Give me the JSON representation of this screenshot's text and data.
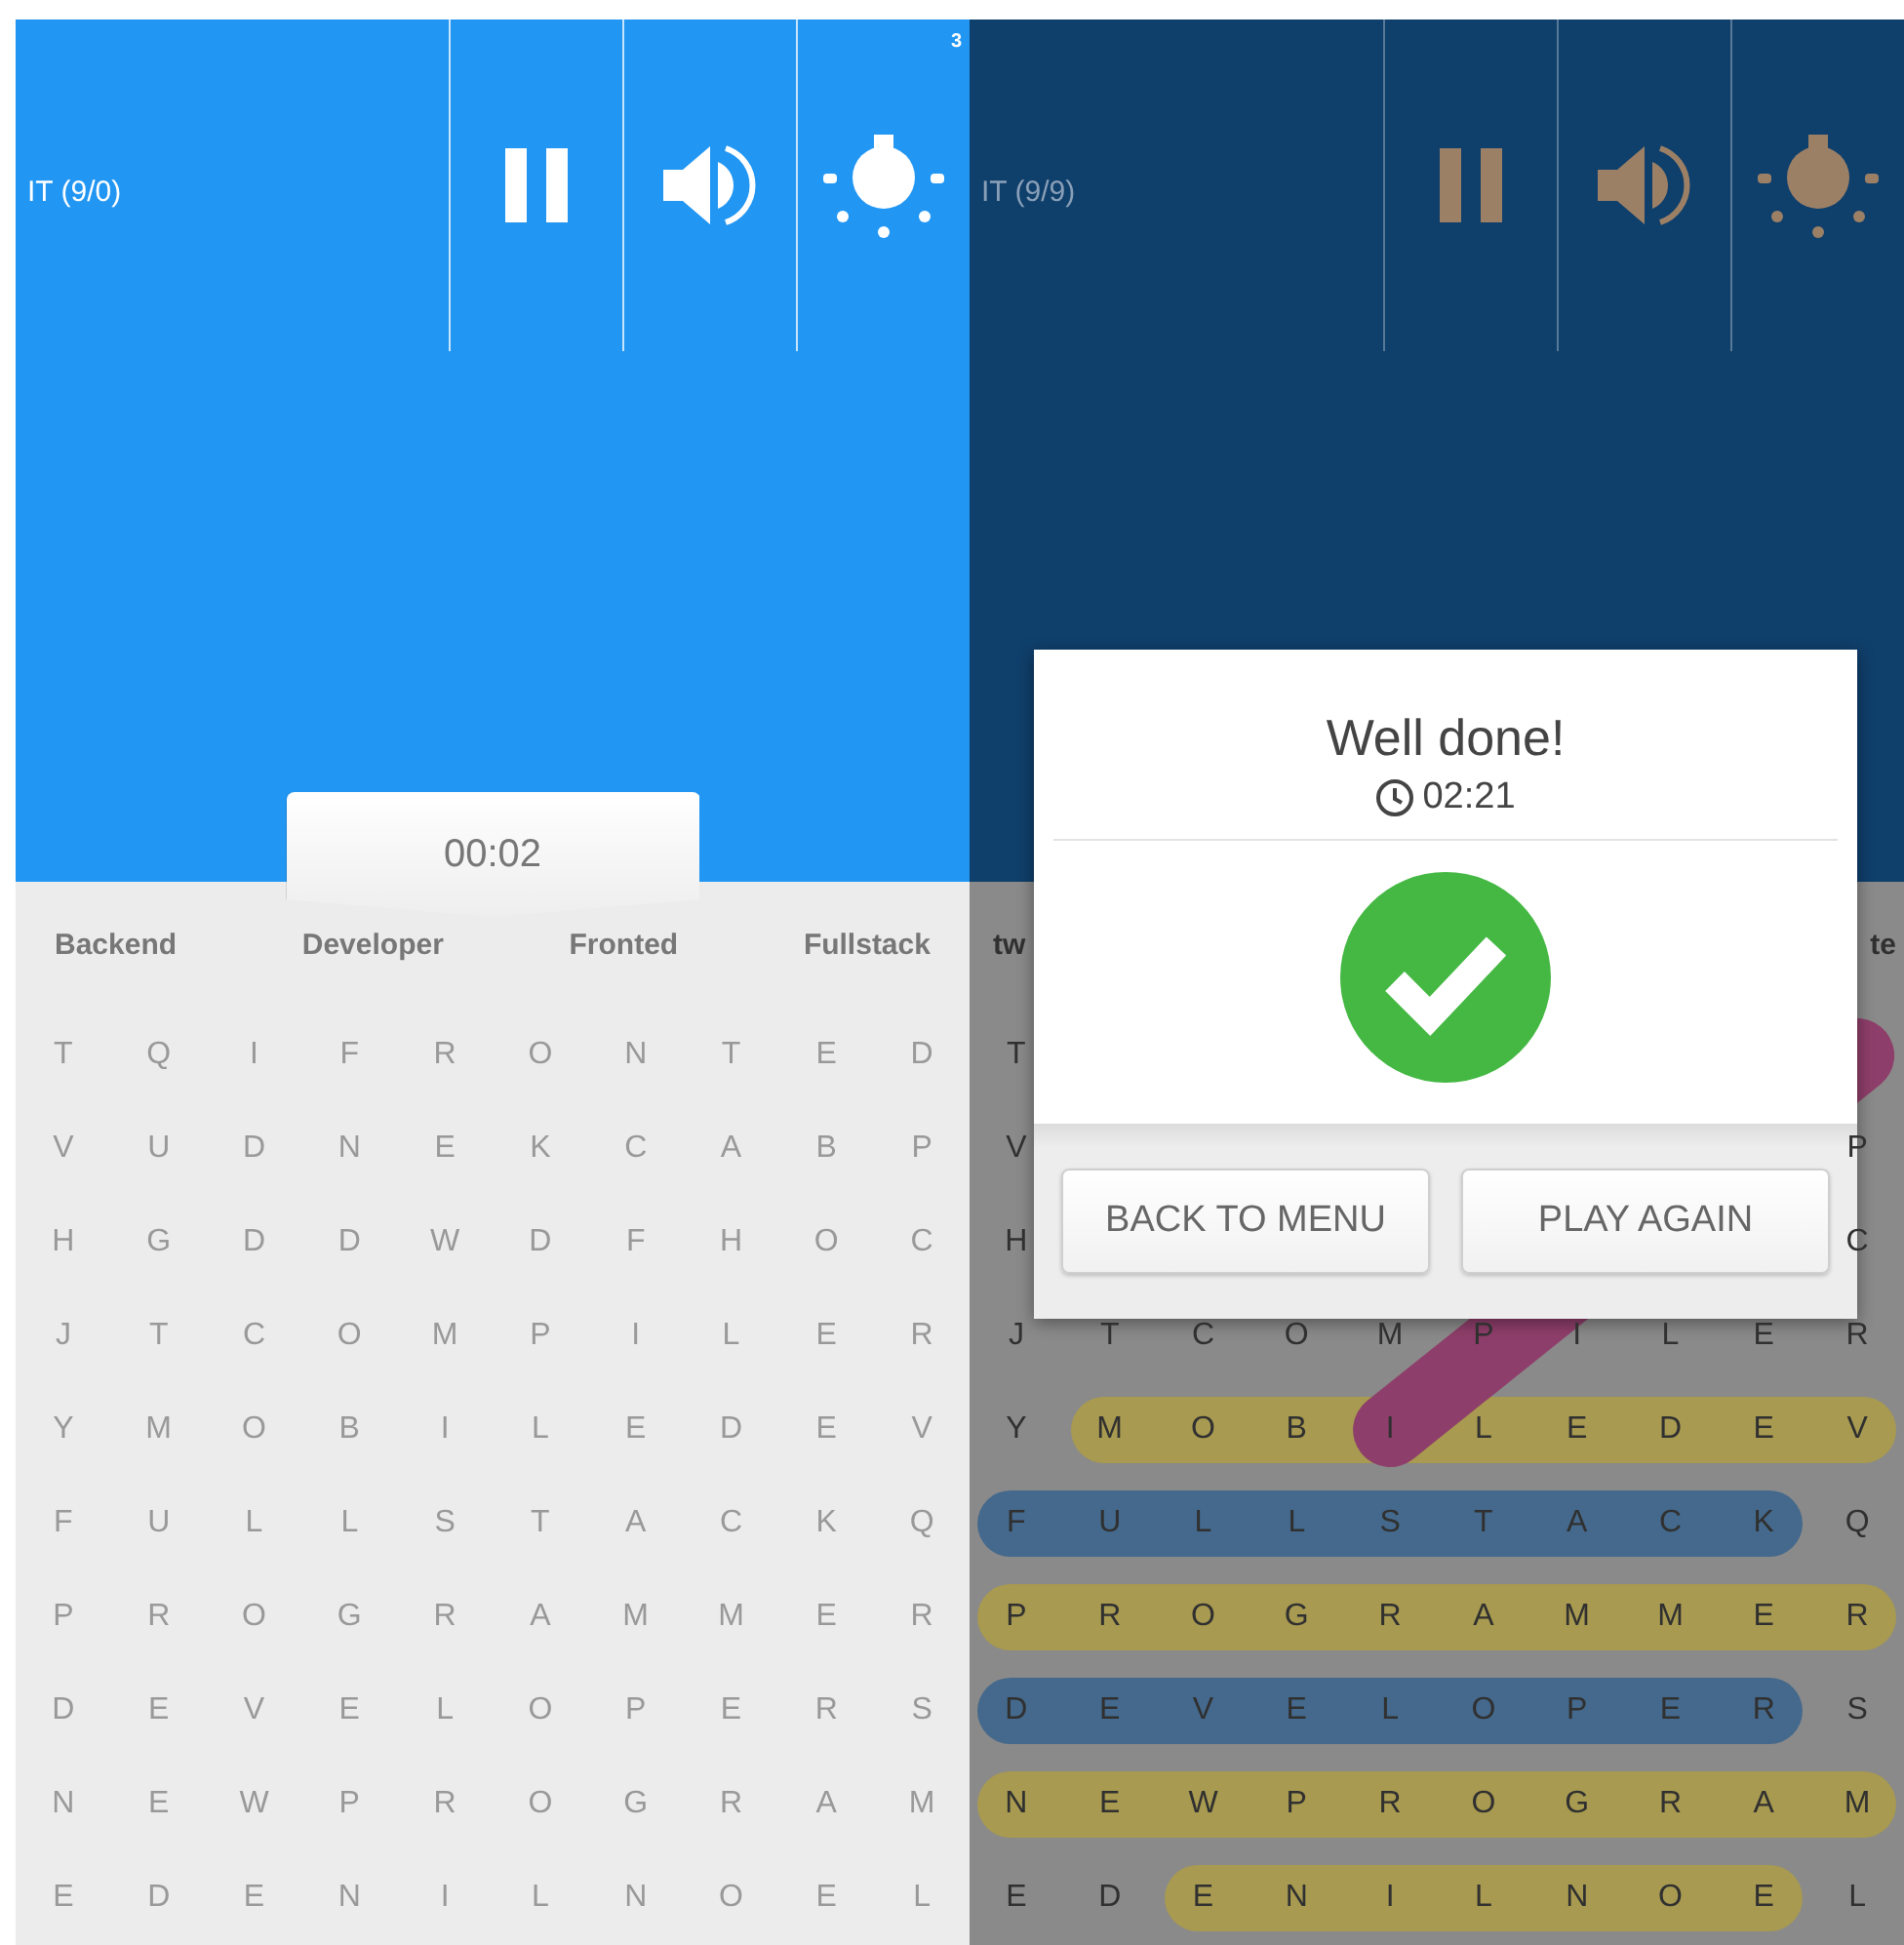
{
  "screens": [
    {
      "title": "IT (9/0)",
      "badge": "3",
      "timer": "00:02",
      "dimmed": false,
      "words": [
        "Backend",
        "Developer",
        "Fronted",
        "Fullstack"
      ],
      "grid": [
        [
          "T",
          "Q",
          "I",
          "F",
          "R",
          "O",
          "N",
          "T",
          "E",
          "D"
        ],
        [
          "V",
          "U",
          "D",
          "N",
          "E",
          "K",
          "C",
          "A",
          "B",
          "P"
        ],
        [
          "H",
          "G",
          "D",
          "D",
          "W",
          "D",
          "F",
          "H",
          "O",
          "C"
        ],
        [
          "J",
          "T",
          "C",
          "O",
          "M",
          "P",
          "I",
          "L",
          "E",
          "R"
        ],
        [
          "Y",
          "M",
          "O",
          "B",
          "I",
          "L",
          "E",
          "D",
          "E",
          "V"
        ],
        [
          "F",
          "U",
          "L",
          "L",
          "S",
          "T",
          "A",
          "C",
          "K",
          "Q"
        ],
        [
          "P",
          "R",
          "O",
          "G",
          "R",
          "A",
          "M",
          "M",
          "E",
          "R"
        ],
        [
          "D",
          "E",
          "V",
          "E",
          "L",
          "O",
          "P",
          "E",
          "R",
          "S"
        ],
        [
          "N",
          "E",
          "W",
          "P",
          "R",
          "O",
          "G",
          "R",
          "A",
          "M"
        ],
        [
          "E",
          "D",
          "E",
          "N",
          "I",
          "L",
          "N",
          "O",
          "E",
          "L"
        ]
      ]
    },
    {
      "title": "IT (9/9)",
      "dimmed": true,
      "words": [
        "tw",
        "te"
      ],
      "grid": [
        [
          "T"
        ],
        [
          "V",
          "P"
        ],
        [
          "H",
          "C"
        ],
        [
          "J",
          "T",
          "C",
          "O",
          "M",
          "P",
          "I",
          "L",
          "E",
          "R"
        ],
        [
          "Y",
          "M",
          "O",
          "B",
          "I",
          "L",
          "E",
          "D",
          "E",
          "V"
        ],
        [
          "F",
          "U",
          "L",
          "L",
          "S",
          "T",
          "A",
          "C",
          "K",
          "Q"
        ],
        [
          "P",
          "R",
          "O",
          "G",
          "R",
          "A",
          "M",
          "M",
          "E",
          "R"
        ],
        [
          "D",
          "E",
          "V",
          "E",
          "L",
          "O",
          "P",
          "E",
          "R",
          "S"
        ],
        [
          "N",
          "E",
          "W",
          "P",
          "R",
          "O",
          "G",
          "R",
          "A",
          "M"
        ],
        [
          "E",
          "D",
          "E",
          "N",
          "I",
          "L",
          "N",
          "O",
          "E",
          "L"
        ]
      ],
      "highlights": [
        {
          "color": "#8e3e6a"
        },
        {
          "color": "#a89a50"
        },
        {
          "color": "#44698c"
        },
        {
          "color": "#a89a50"
        },
        {
          "color": "#44698c"
        },
        {
          "color": "#a89a50"
        },
        {
          "color": "#a89a50"
        }
      ],
      "dialog": {
        "title": "Well done!",
        "time": "02:21",
        "buttons": [
          "BACK TO MENU",
          "PLAY AGAIN"
        ]
      }
    }
  ]
}
